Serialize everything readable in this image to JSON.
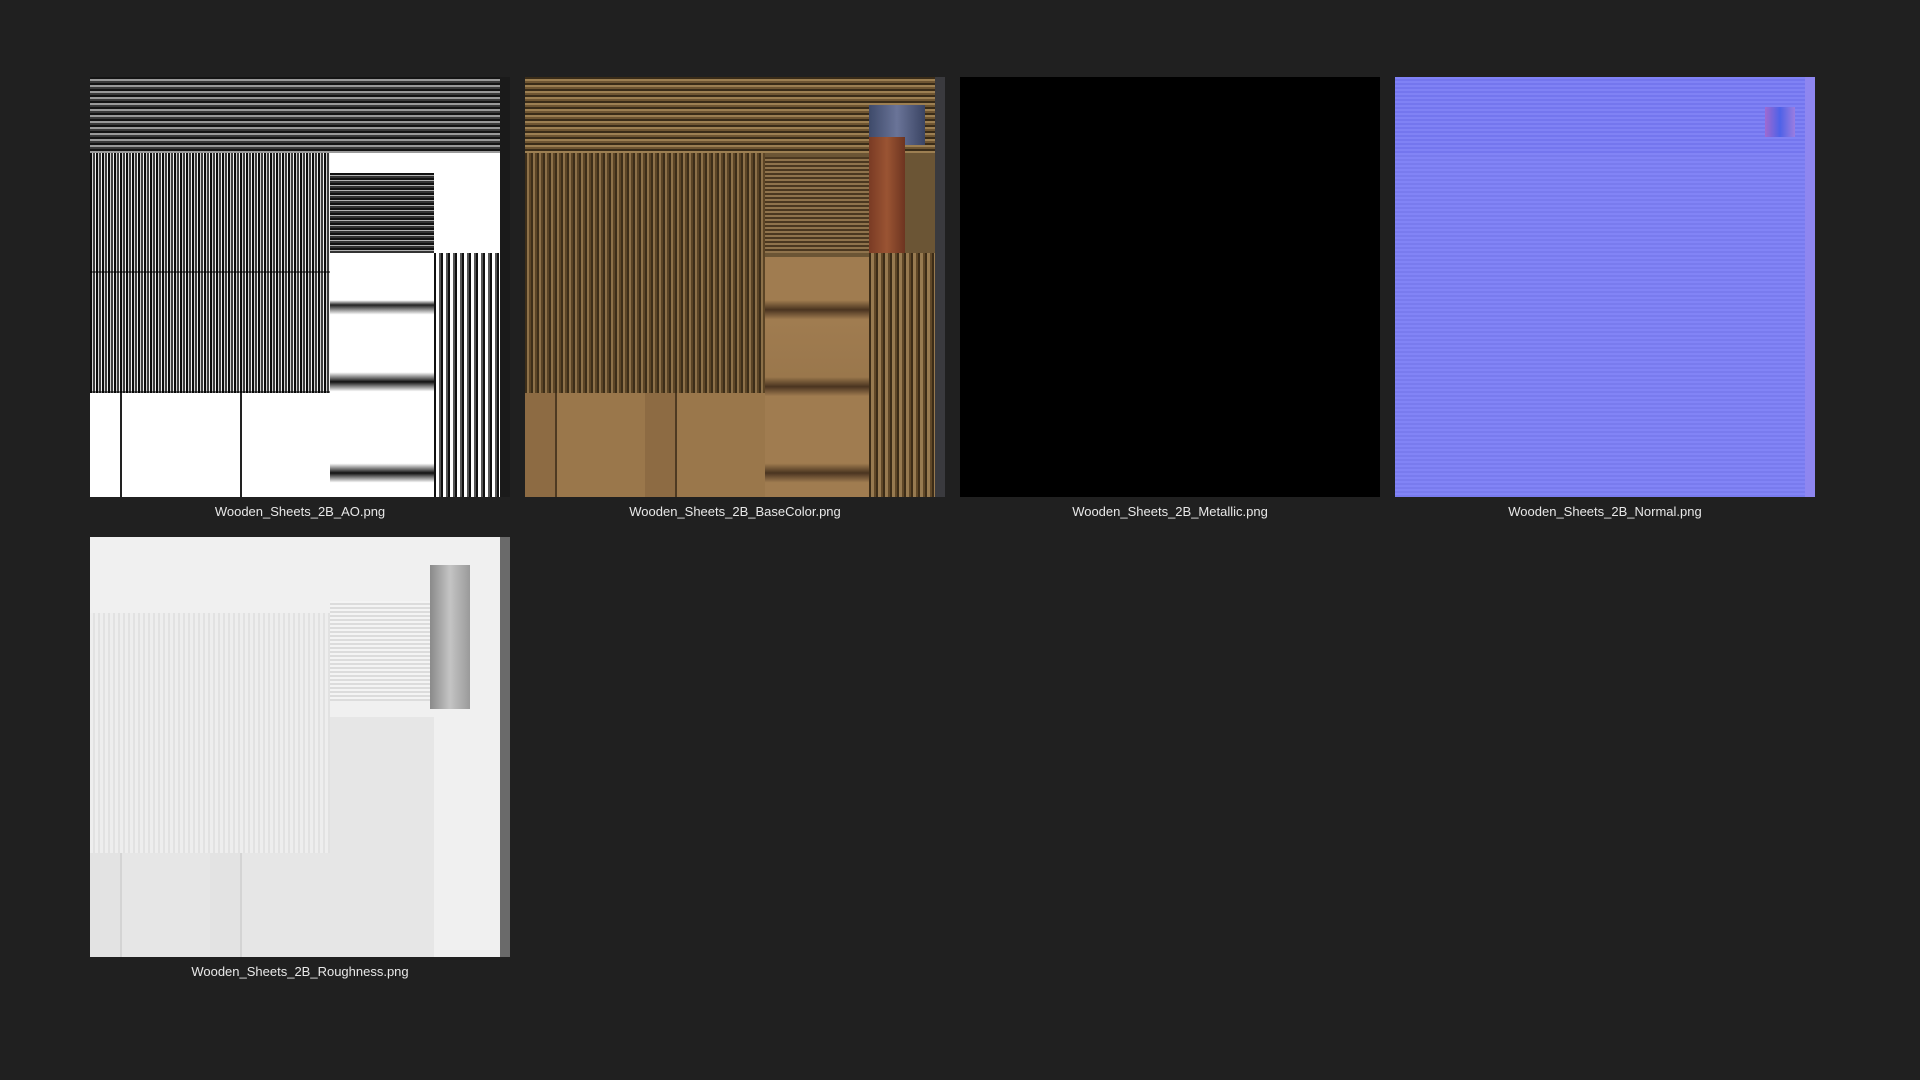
{
  "gallery": {
    "items": [
      {
        "filename": "Wooden_Sheets_2B_AO.png"
      },
      {
        "filename": "Wooden_Sheets_2B_BaseColor.png"
      },
      {
        "filename": "Wooden_Sheets_2B_Metallic.png"
      },
      {
        "filename": "Wooden_Sheets_2B_Normal.png"
      },
      {
        "filename": "Wooden_Sheets_2B_Roughness.png"
      }
    ]
  },
  "colors": {
    "background": "#202020",
    "caption_text": "#e8e8e8",
    "normal_map_base": "#7d7ff6",
    "metallic_fill": "#000000"
  }
}
